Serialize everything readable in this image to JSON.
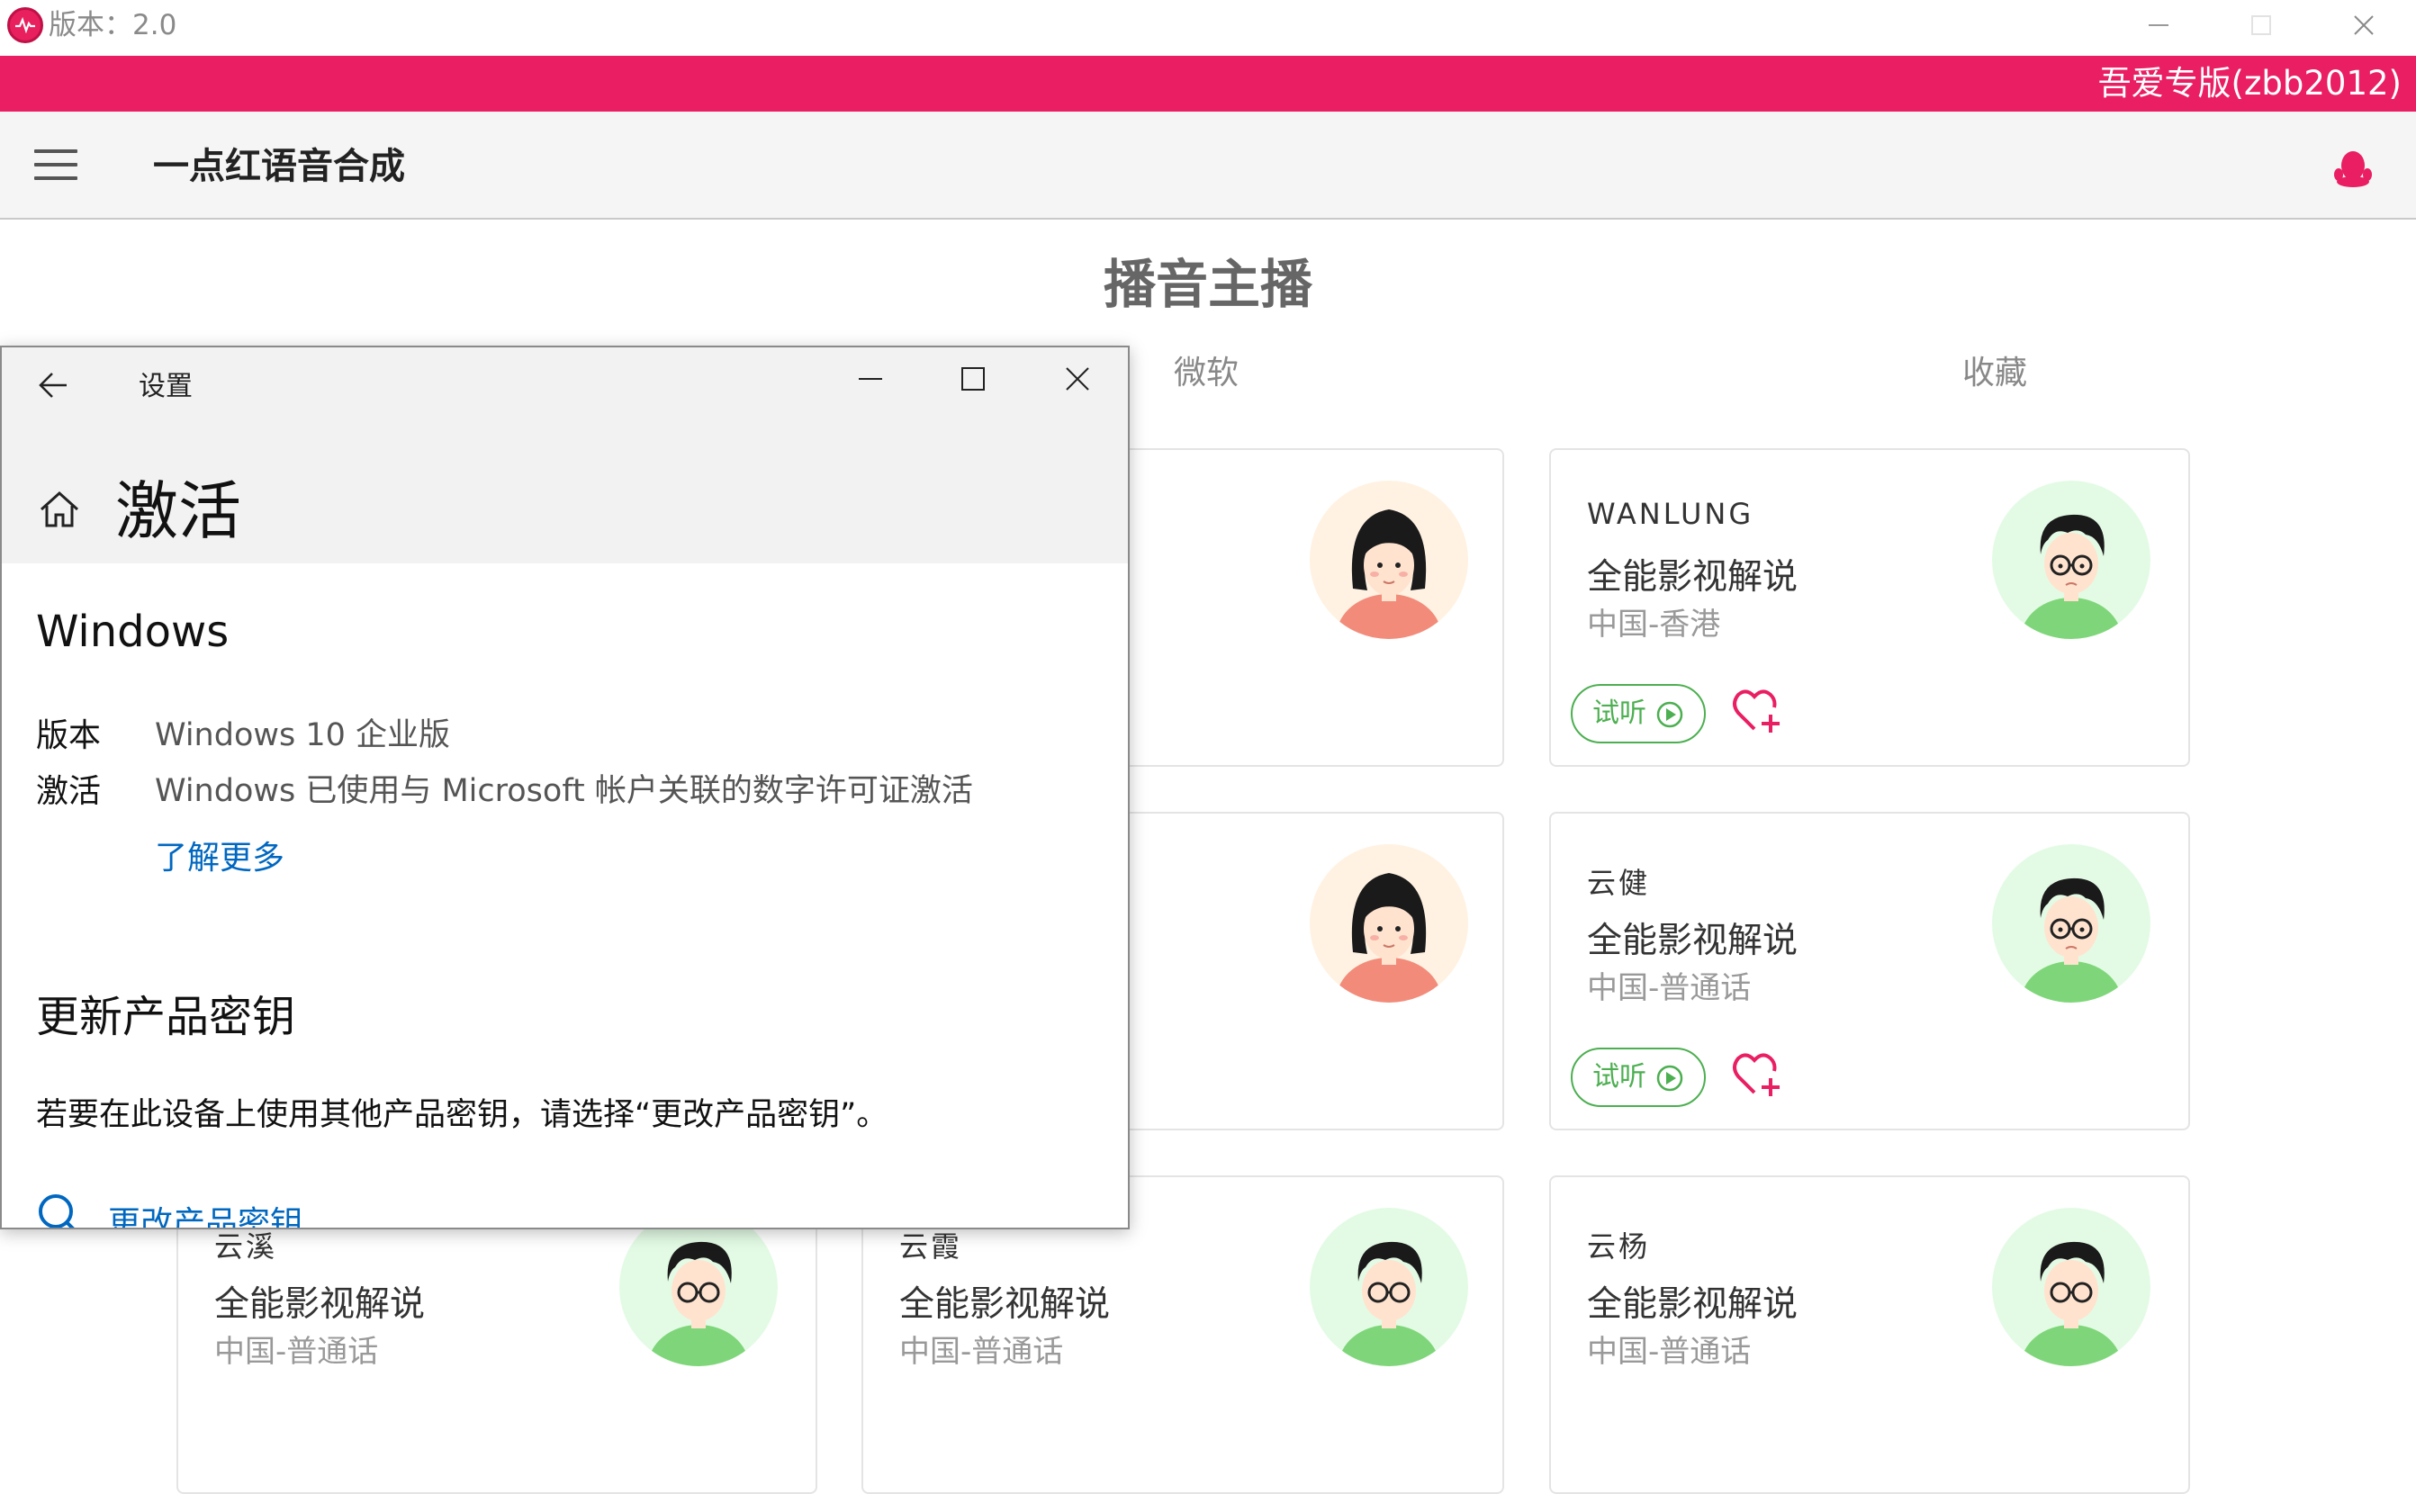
{
  "window": {
    "title": "版本：2.0",
    "banner_text": "吾爱专版(zbb2012)"
  },
  "toolbar": {
    "app_name": "一点红语音合成"
  },
  "main": {
    "page_title": "播音主播",
    "tabs": [
      {
        "label": "微软"
      },
      {
        "label": "收藏"
      }
    ],
    "cards": [
      {
        "name": "WANLUNG",
        "desc": "全能影视解说",
        "region": "中国-香港",
        "listen_label": "试听",
        "avatar": "male"
      },
      {
        "name": "云健",
        "desc": "全能影视解说",
        "region": "中国-普通话",
        "listen_label": "试听",
        "avatar": "male"
      },
      {
        "name": "云溪",
        "desc": "全能影视解说",
        "region": "中国-普通话",
        "avatar": "male"
      },
      {
        "name": "云霞",
        "desc": "全能影视解说",
        "region": "中国-普通话",
        "avatar": "male"
      },
      {
        "name": "云杨",
        "desc": "全能影视解说",
        "region": "中国-普通话",
        "avatar": "male"
      }
    ]
  },
  "settings": {
    "title": "设置",
    "page_heading": "激活",
    "section_windows": "Windows",
    "edition_label": "版本",
    "edition_value": "Windows 10 企业版",
    "activation_label": "激活",
    "activation_value": "Windows 已使用与 Microsoft 帐户关联的数字许可证激活",
    "learn_more": "了解更多",
    "section_key": "更新产品密钥",
    "key_text": "若要在此设备上使用其他产品密钥，请选择“更改产品密钥”。",
    "change_key_link": "更改产品密钥"
  },
  "colors": {
    "brand_pink": "#e91e63",
    "listen_green": "#4caf50",
    "link_blue": "#0067c0"
  },
  "icons": [
    "app-logo-icon",
    "minimize-icon",
    "maximize-icon",
    "close-icon",
    "hamburger-menu-icon",
    "qq-penguin-icon",
    "back-arrow-icon",
    "home-icon",
    "play-circle-icon",
    "favorite-add-icon",
    "search-key-icon"
  ]
}
